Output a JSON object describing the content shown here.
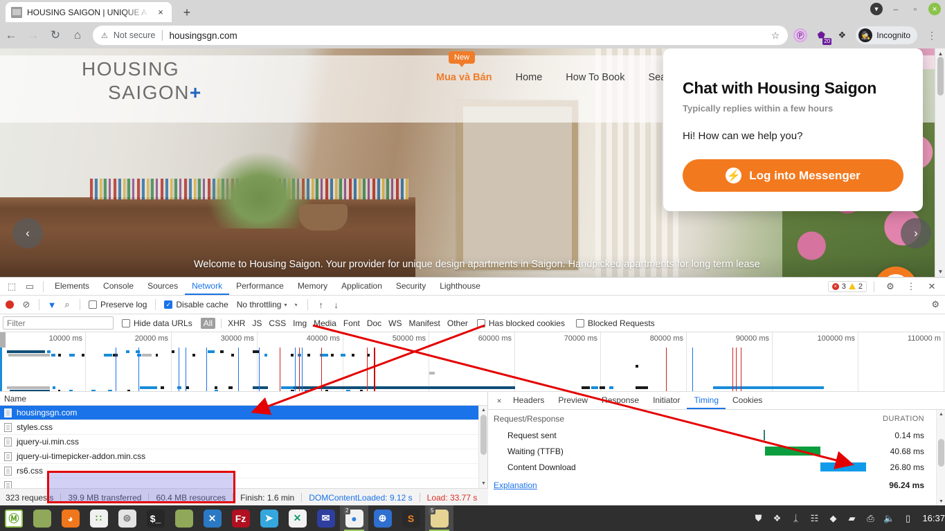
{
  "browser": {
    "tab": {
      "title": "HOUSING SAIGON | UNIQUE A",
      "close": "×",
      "favicon": "page-favicon"
    },
    "new_tab": "+",
    "window_controls": {
      "menu": "▼",
      "minimize": "–",
      "maximize": "▫",
      "close": "×"
    },
    "nav": {
      "back": "←",
      "forward": "→",
      "reload": "↻",
      "home": "⌂"
    },
    "omnibox": {
      "security_icon": "⚠",
      "security_text": "Not secure",
      "separator": "|",
      "url": "housingsgn.com",
      "bookmark_star": "☆"
    },
    "extensions": [
      {
        "name": "privacy-badger-icon",
        "glyph": "Ⓟ",
        "badge": ""
      },
      {
        "name": "adblock-icon",
        "glyph": "⬟",
        "badge": "20"
      },
      {
        "name": "extensions-puzzle-icon",
        "glyph": "❖",
        "badge": ""
      }
    ],
    "profile": {
      "label": "Incognito",
      "icon": "🕵"
    },
    "menu": "⋮"
  },
  "page": {
    "brand": {
      "line1": "HOUSING",
      "line2": "SAIGON",
      "plus": "+"
    },
    "nav_items": [
      {
        "label": "Mua và Bán",
        "accent": true,
        "badge": "New"
      },
      {
        "label": "Home",
        "accent": false,
        "badge": ""
      },
      {
        "label": "How To Book",
        "accent": false,
        "badge": ""
      },
      {
        "label": "Search b",
        "accent": false,
        "badge": ""
      }
    ],
    "caption": "Welcome to Housing Saigon. Your provider for unique design apartments in Saigon. Handpicked apartments for long term lease",
    "carousel": {
      "prev": "‹",
      "next": "›"
    },
    "chat": {
      "title": "Chat with Housing Saigon",
      "subtitle": "Typically replies within a few hours",
      "message": "Hi! How can we help you?",
      "button": "Log into Messenger",
      "button_color": "#f3791f",
      "fab_icon": "messenger-icon"
    }
  },
  "devtools": {
    "panel_tabs": [
      {
        "label": "Elements",
        "active": false
      },
      {
        "label": "Console",
        "active": false
      },
      {
        "label": "Sources",
        "active": false
      },
      {
        "label": "Network",
        "active": true
      },
      {
        "label": "Performance",
        "active": false
      },
      {
        "label": "Memory",
        "active": false
      },
      {
        "label": "Application",
        "active": false
      },
      {
        "label": "Security",
        "active": false
      },
      {
        "label": "Lighthouse",
        "active": false
      }
    ],
    "inspect_icon": "⬚",
    "device_icon": "▭",
    "issues": {
      "errors": "3",
      "warnings": "2",
      "error_mark": "×"
    },
    "settings_icon": "⚙",
    "more_icon": "⋮",
    "close_icon": "✕",
    "controls": {
      "record": "record-button",
      "clear": "⊘",
      "filter": "▼",
      "search": "⌕",
      "preserve_log": "Preserve log",
      "preserve_log_checked": false,
      "disable_cache": "Disable cache",
      "disable_cache_checked": true,
      "throttling": "No throttling",
      "caret": "▾",
      "wifi_icon": "◔",
      "import_icon": "↑",
      "export_icon": "↓"
    },
    "filters": {
      "placeholder": "Filter",
      "value": "",
      "hide_data_urls": "Hide data URLs",
      "hide_data_urls_checked": false,
      "types": [
        "All",
        "XHR",
        "JS",
        "CSS",
        "Img",
        "Media",
        "Font",
        "Doc",
        "WS",
        "Manifest",
        "Other"
      ],
      "selected_type": "All",
      "has_blocked_cookies": "Has blocked cookies",
      "has_blocked_cookies_checked": false,
      "blocked_requests": "Blocked Requests",
      "blocked_requests_checked": false,
      "gear_icon": "⚙"
    },
    "overview": {
      "ticks": [
        "10000 ms",
        "20000 ms",
        "30000 ms",
        "40000 ms",
        "50000 ms",
        "60000 ms",
        "70000 ms",
        "80000 ms",
        "90000 ms",
        "100000 ms",
        "110000 m"
      ]
    },
    "requests": {
      "column_name": "Name",
      "rows": [
        {
          "name": "housingsgn.com",
          "selected": true
        },
        {
          "name": "styles.css",
          "selected": false
        },
        {
          "name": "jquery-ui.min.css",
          "selected": false
        },
        {
          "name": "jquery-ui-timepicker-addon.min.css",
          "selected": false
        },
        {
          "name": "rs6.css",
          "selected": false
        }
      ],
      "scroll_up": "▲",
      "scroll_down": "▼"
    },
    "detail": {
      "close": "×",
      "tabs": [
        {
          "label": "Headers",
          "active": false
        },
        {
          "label": "Preview",
          "active": false
        },
        {
          "label": "Response",
          "active": false
        },
        {
          "label": "Initiator",
          "active": false
        },
        {
          "label": "Timing",
          "active": true
        },
        {
          "label": "Cookies",
          "active": false
        }
      ],
      "group_label": "Request/Response",
      "duration_header": "DURATION",
      "rows": [
        {
          "label": "Request sent",
          "duration": "0.14 ms",
          "bar": "tick",
          "left_pct": 40,
          "width_pct": 0.4,
          "color": "#2f7f72"
        },
        {
          "label": "Waiting (TTFB)",
          "duration": "40.68 ms",
          "bar": "green",
          "left_pct": 40.5,
          "width_pct": 25.5,
          "color": "#0b9e3e"
        },
        {
          "label": "Content Download",
          "duration": "26.80 ms",
          "bar": "blue",
          "left_pct": 65.5,
          "width_pct": 20.5,
          "color": "#0f9bea"
        }
      ],
      "explanation": "Explanation",
      "total": "96.24 ms",
      "scroll_up": "▲",
      "scroll_down": "▼"
    },
    "status": {
      "requests": "323 requests",
      "transferred": "39.9 MB transferred",
      "resources": "60.4 MB resources",
      "finish": "Finish: 1.6 min",
      "dom_content_loaded": "DOMContentLoaded: 9.12 s",
      "load": "Load: 33.77 s"
    }
  },
  "taskbar": {
    "start": "start-menu-icon",
    "items": [
      {
        "name": "linux-mint-menu-icon",
        "glyph": "Ⓜ",
        "bg": "#ffffff",
        "fg": "#5ba321",
        "badge": "",
        "active": false
      },
      {
        "name": "files-icon",
        "glyph": "",
        "bg": "#8fa85a",
        "fg": "#fff",
        "badge": "",
        "active": false
      },
      {
        "name": "firefox-icon",
        "glyph": "◕",
        "bg": "#f0761c",
        "fg": "#fff",
        "badge": "",
        "active": false
      },
      {
        "name": "calculator-icon",
        "glyph": "∷",
        "bg": "#f0f0f0",
        "fg": "#4e9a2e",
        "badge": "",
        "active": false
      },
      {
        "name": "settings-toggle-icon",
        "glyph": "⊜",
        "bg": "#e4e4e4",
        "fg": "#777",
        "badge": "",
        "active": false
      },
      {
        "name": "terminal-icon",
        "glyph": "$_",
        "bg": "#272727",
        "fg": "#fff",
        "badge": "",
        "active": false
      },
      {
        "name": "file-manager-icon",
        "glyph": "",
        "bg": "#8fa85a",
        "fg": "#fff",
        "badge": "",
        "active": false
      },
      {
        "name": "vscode-icon",
        "glyph": "⨯",
        "bg": "#2b79c4",
        "fg": "#fff",
        "badge": "",
        "active": false
      },
      {
        "name": "filezilla-icon",
        "glyph": "Fz",
        "bg": "#b01020",
        "fg": "#fff",
        "badge": "",
        "active": false
      },
      {
        "name": "telegram-icon",
        "glyph": "➤",
        "bg": "#35a7dd",
        "fg": "#fff",
        "badge": "",
        "active": false
      },
      {
        "name": "xmind-icon",
        "glyph": "✕",
        "bg": "#f2f2f2",
        "fg": "#149c6b",
        "badge": "",
        "active": false
      },
      {
        "name": "mail-icon",
        "glyph": "✉",
        "bg": "#2f3fa0",
        "fg": "#fff",
        "badge": "",
        "active": false
      },
      {
        "name": "chrome-icon",
        "glyph": "●",
        "bg": "#f1f1f1",
        "fg": "#2f7fe0",
        "badge": "2",
        "active": true
      },
      {
        "name": "globe-icon",
        "glyph": "⊕",
        "bg": "#2f6fd0",
        "fg": "#fff",
        "badge": "",
        "active": false
      },
      {
        "name": "sublime-text-icon",
        "glyph": "S",
        "bg": "#2a2a2a",
        "fg": "#f58220",
        "badge": "",
        "active": false
      },
      {
        "name": "notes-icon",
        "glyph": "",
        "bg": "#e5d493",
        "fg": "#777",
        "badge": "5",
        "active": true
      }
    ],
    "tray": [
      {
        "name": "shield-icon",
        "glyph": "⛊"
      },
      {
        "name": "dropbox-icon",
        "glyph": "❖"
      },
      {
        "name": "bluetooth-icon",
        "glyph": "ᛣ"
      },
      {
        "name": "colors-icon",
        "glyph": "☷"
      },
      {
        "name": "anydesk-icon",
        "glyph": "◆"
      },
      {
        "name": "folder-tray-icon",
        "glyph": "▰"
      },
      {
        "name": "printer-icon",
        "glyph": "⎙"
      },
      {
        "name": "volume-muted-icon",
        "glyph": "🔈"
      },
      {
        "name": "battery-icon",
        "glyph": "▯"
      }
    ],
    "clock": "16:37"
  }
}
